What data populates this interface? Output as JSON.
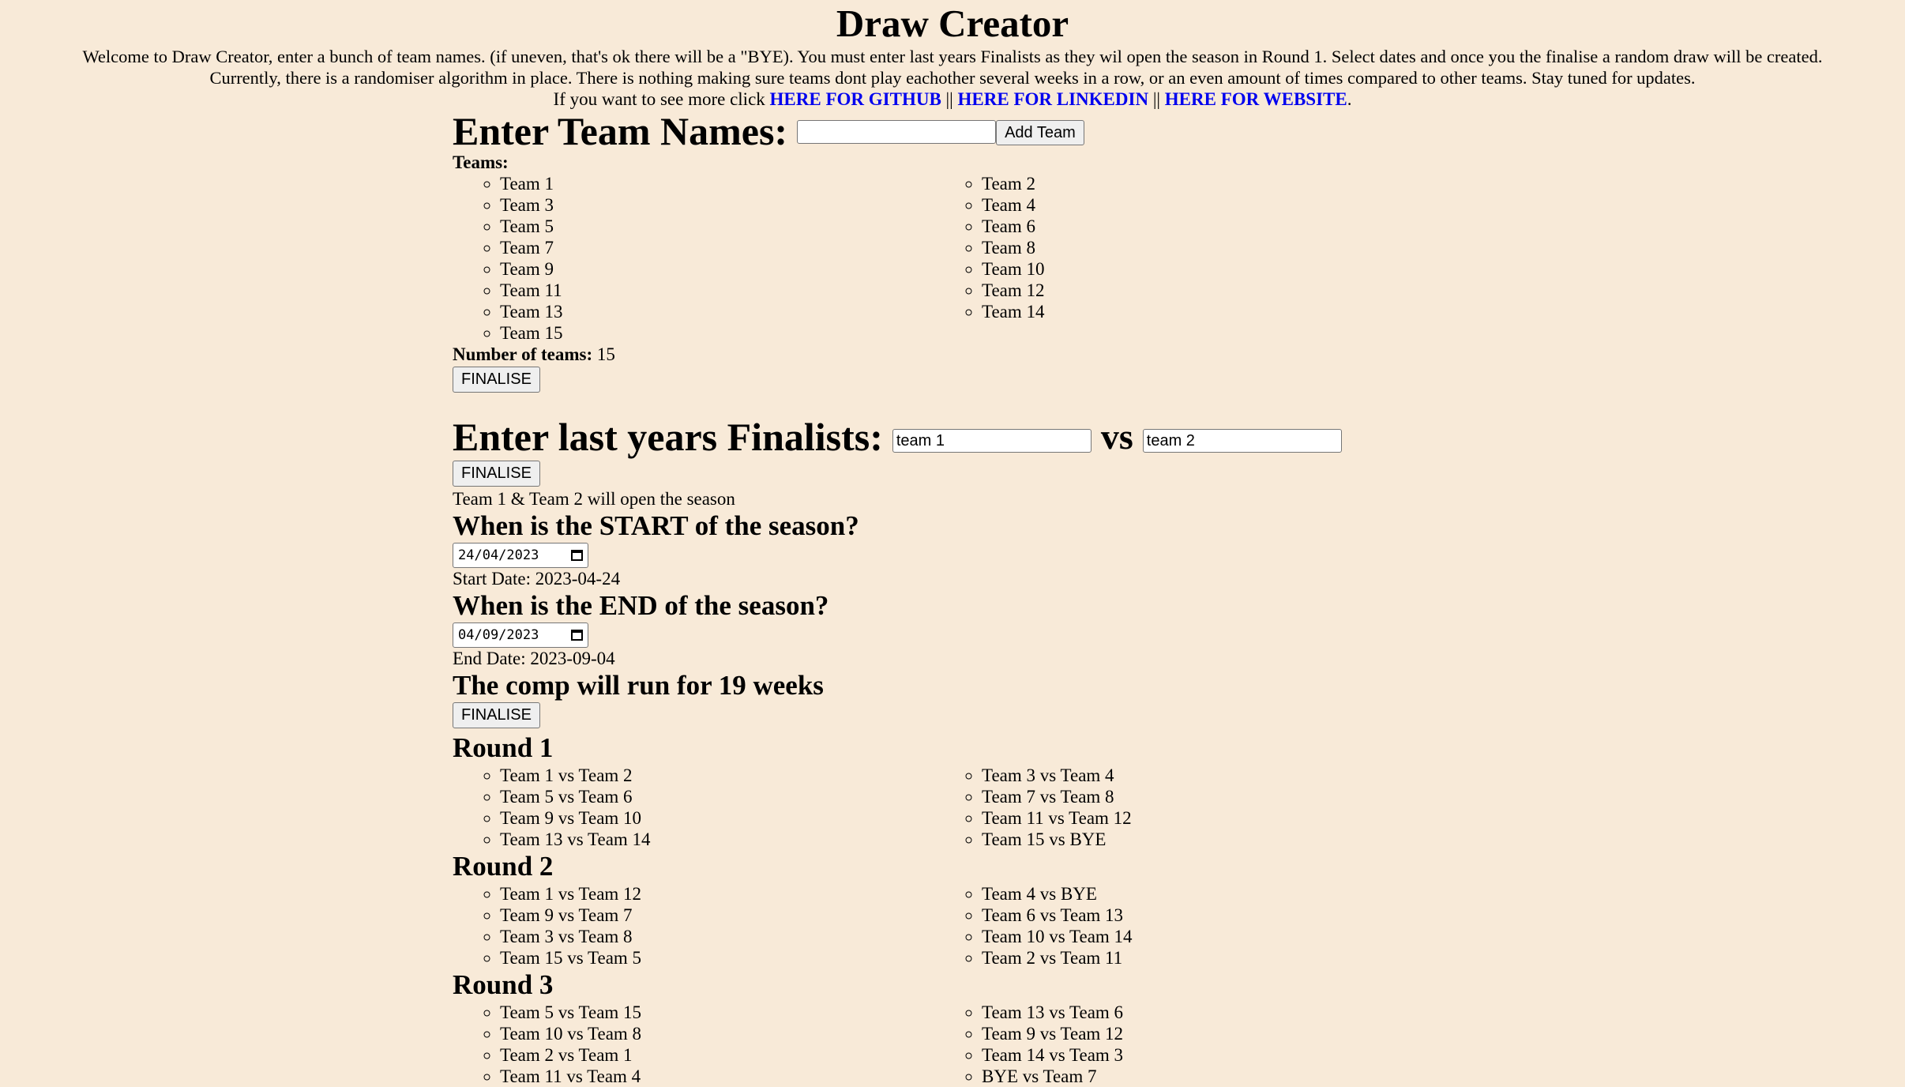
{
  "header": {
    "title": "Draw Creator",
    "intro_line1": "Welcome to Draw Creator, enter a bunch of team names. (if uneven, that's ok there will be a \"BYE). You must enter last years Finalists as they wil open the season in Round 1. Select dates and once you the finalise a random draw will be created.",
    "intro_line2": "Currently, there is a randomiser algorithm in place. There is nothing making sure teams dont play eachother several weeks in a row, or an even amount of times compared to other teams. Stay tuned for updates.",
    "links_prefix": "If you want to see more click",
    "link_github": "HERE FOR GITHUB",
    "link_linkedin": "HERE FOR LINKEDIN",
    "link_website": "HERE FOR WEBSITE",
    "separator": "||",
    "period": "."
  },
  "teams_section": {
    "heading": "Enter Team Names:",
    "input_value": "",
    "add_button": "Add Team",
    "teams_label": "Teams:",
    "teams": [
      "Team 1",
      "Team 2",
      "Team 3",
      "Team 4",
      "Team 5",
      "Team 6",
      "Team 7",
      "Team 8",
      "Team 9",
      "Team 10",
      "Team 11",
      "Team 12",
      "Team 13",
      "Team 14",
      "Team 15"
    ],
    "count_label": "Number of teams:",
    "count_value": "15",
    "finalise_button": "FINALISE"
  },
  "finalists_section": {
    "heading": "Enter last years Finalists:",
    "team1_value": "team 1",
    "vs_label": "vs",
    "team2_value": "team 2",
    "finalise_button": "FINALISE",
    "status": "Team 1 & Team 2 will open the season"
  },
  "dates_section": {
    "start_heading": "When is the START of the season?",
    "start_input": "24/04/2023",
    "start_text": "Start Date: 2023-04-24",
    "end_heading": "When is the END of the season?",
    "end_input": "04/09/2023",
    "end_text": "End Date: 2023-09-04",
    "weeks_text": "The comp will run for 19 weeks",
    "finalise_button": "FINALISE"
  },
  "rounds": [
    {
      "title": "Round 1",
      "matches": [
        "Team 1 vs Team 2",
        "Team 3 vs Team 4",
        "Team 5 vs Team 6",
        "Team 7 vs Team 8",
        "Team 9 vs Team 10",
        "Team 11 vs Team 12",
        "Team 13 vs Team 14",
        "Team 15 vs BYE"
      ]
    },
    {
      "title": "Round 2",
      "matches": [
        "Team 1 vs Team 12",
        "Team 4 vs BYE",
        "Team 9 vs Team 7",
        "Team 6 vs Team 13",
        "Team 3 vs Team 8",
        "Team 10 vs Team 14",
        "Team 15 vs Team 5",
        "Team 2 vs Team 11"
      ]
    },
    {
      "title": "Round 3",
      "matches": [
        "Team 5 vs Team 15",
        "Team 13 vs Team 6",
        "Team 10 vs Team 8",
        "Team 9 vs Team 12",
        "Team 2 vs Team 1",
        "Team 14 vs Team 3",
        "Team 11 vs Team 4",
        "BYE vs Team 7"
      ]
    }
  ]
}
